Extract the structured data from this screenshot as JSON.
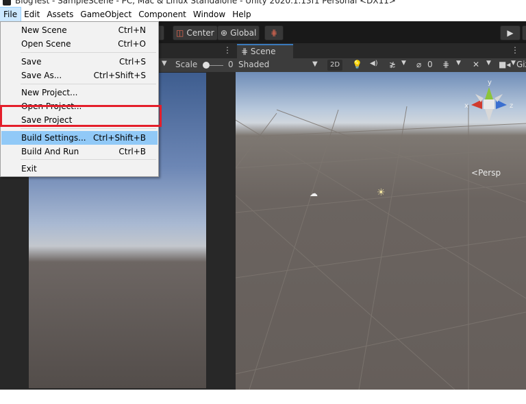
{
  "window": {
    "title": "BlogTest - SampleScene - PC, Mac & Linux Standalone - Unity 2020.1.13f1 Personal <DX11>"
  },
  "menubar": [
    "File",
    "Edit",
    "Assets",
    "GameObject",
    "Component",
    "Window",
    "Help"
  ],
  "toolbar": {
    "center_label": "Center",
    "global_label": "Global"
  },
  "game_panel": {
    "scale_label": "Scale",
    "scale_value": "0"
  },
  "scene_panel": {
    "tab_label": "Scene",
    "shading": "Shaded",
    "btn_2d": "2D",
    "hidden_count": "0",
    "gizmos_label": "Giz",
    "persp_label": "Persp",
    "axes": {
      "x": "x",
      "y": "y",
      "z": "z"
    }
  },
  "file_menu": {
    "items": [
      {
        "label": "New Scene",
        "shortcut": "Ctrl+N"
      },
      {
        "label": "Open Scene",
        "shortcut": "Ctrl+O"
      },
      {
        "label": "Save",
        "shortcut": "Ctrl+S"
      },
      {
        "label": "Save As...",
        "shortcut": "Ctrl+Shift+S"
      },
      {
        "label": "New Project...",
        "shortcut": ""
      },
      {
        "label": "Open Project...",
        "shortcut": ""
      },
      {
        "label": "Save Project",
        "shortcut": ""
      },
      {
        "label": "Build Settings...",
        "shortcut": "Ctrl+Shift+B"
      },
      {
        "label": "Build And Run",
        "shortcut": "Ctrl+B"
      },
      {
        "label": "Exit",
        "shortcut": ""
      }
    ]
  },
  "colors": {
    "highlight": "#91c9f7",
    "annotation": "#e41e2a",
    "tab_accent": "#3a79bb"
  }
}
